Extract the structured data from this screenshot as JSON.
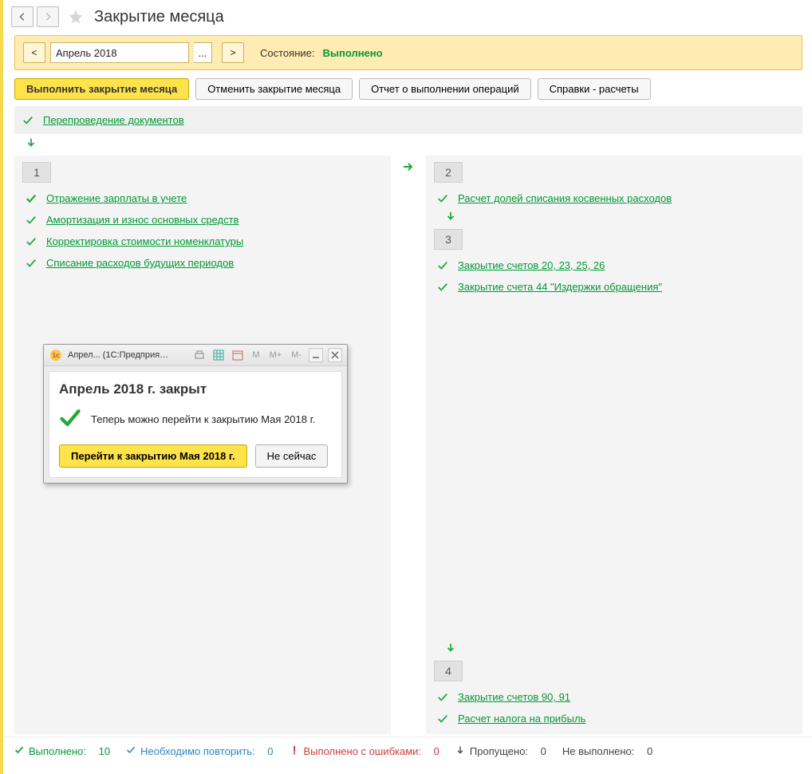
{
  "header": {
    "title": "Закрытие месяца"
  },
  "period_bar": {
    "period": "Апрель 2018",
    "state_label": "Состояние:",
    "state_value": "Выполнено"
  },
  "toolbar": {
    "execute": "Выполнить закрытие месяца",
    "cancel": "Отменить закрытие месяца",
    "report": "Отчет о выполнении операций",
    "refs": "Справки - расчеты"
  },
  "toplink": "Перепроведение документов",
  "stage1": {
    "num": "1",
    "ops": [
      "Отражение зарплаты в учете",
      "Амортизация и износ основных средств",
      "Корректировка стоимости номенклатуры",
      "Списание расходов будущих периодов"
    ]
  },
  "stage2": {
    "num": "2",
    "ops": [
      "Расчет долей списания косвенных расходов"
    ]
  },
  "stage3": {
    "num": "3",
    "ops": [
      "Закрытие счетов 20, 23, 25, 26",
      "Закрытие счета 44 \"Издержки обращения\""
    ]
  },
  "stage4": {
    "num": "4",
    "ops": [
      "Закрытие счетов 90, 91",
      "Расчет налога на прибыль"
    ]
  },
  "dialog": {
    "title": "Апрел...  (1С:Предприятие)",
    "heading": "Апрель 2018 г. закрыт",
    "message": "Теперь можно перейти к закрытию Мая 2018 г.",
    "primary": "Перейти к закрытию Мая 2018 г.",
    "secondary": "Не сейчас"
  },
  "footer": {
    "done_label": "Выполнено:",
    "done": "10",
    "repeat_label": "Необходимо повторить:",
    "repeat": "0",
    "errors_label": "Выполнено с ошибками:",
    "errors": "0",
    "skipped_label": "Пропущено:",
    "skipped": "0",
    "pending_label": "Не выполнено:",
    "pending": "0"
  }
}
